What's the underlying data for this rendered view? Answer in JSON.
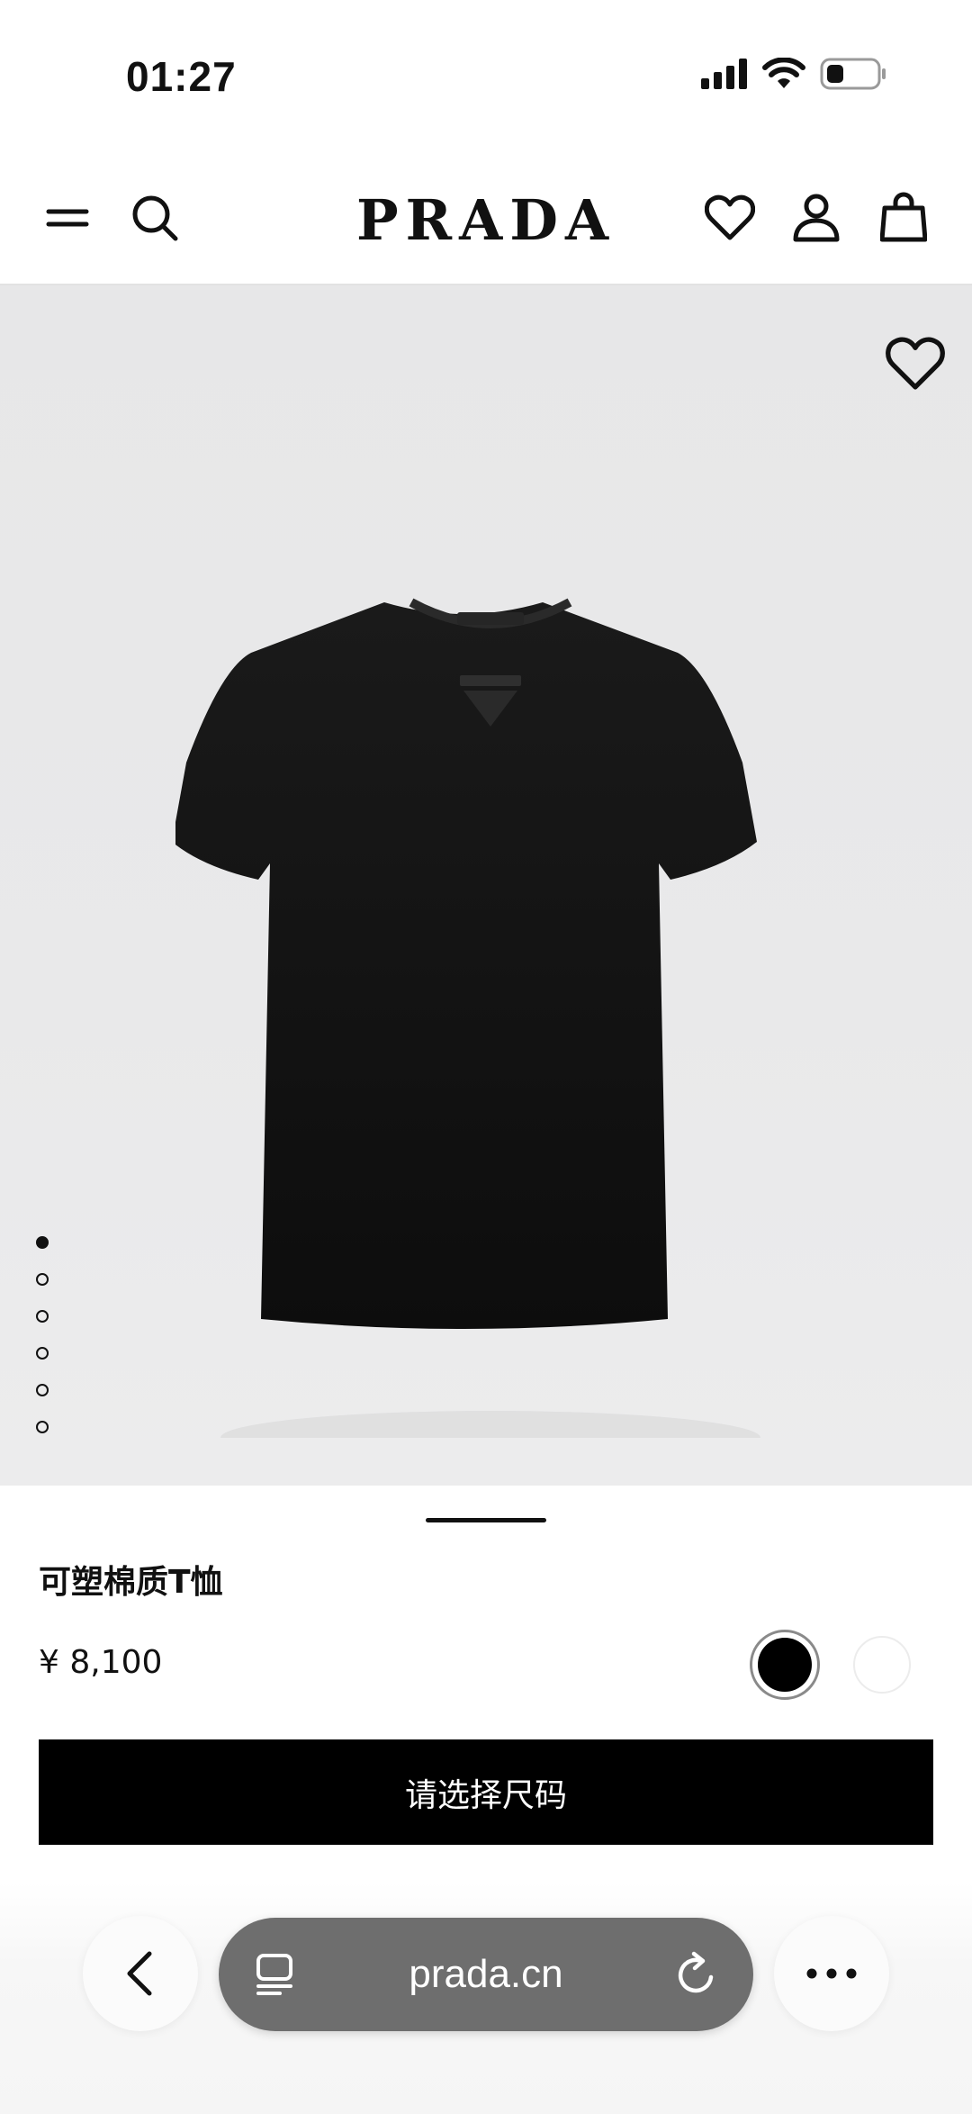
{
  "status_bar": {
    "time": "01:27"
  },
  "header": {
    "brand": "PRADA",
    "icons": [
      "menu-icon",
      "search-icon",
      "heart-icon",
      "account-icon",
      "bag-icon"
    ]
  },
  "gallery": {
    "image_count": 6,
    "active_index": 0,
    "product_image": "black t-shirt"
  },
  "product": {
    "name": "可塑棉质T恤",
    "price": "¥ 8,100",
    "colors": [
      {
        "name": "black",
        "hex": "#000000",
        "selected": true
      },
      {
        "name": "white",
        "hex": "#ffffff",
        "selected": false
      }
    ],
    "cta_label": "请选择尺码"
  },
  "browser": {
    "url": "prada.cn",
    "icons": [
      "back-icon",
      "tabs-icon",
      "reload-icon",
      "more-icon"
    ]
  }
}
